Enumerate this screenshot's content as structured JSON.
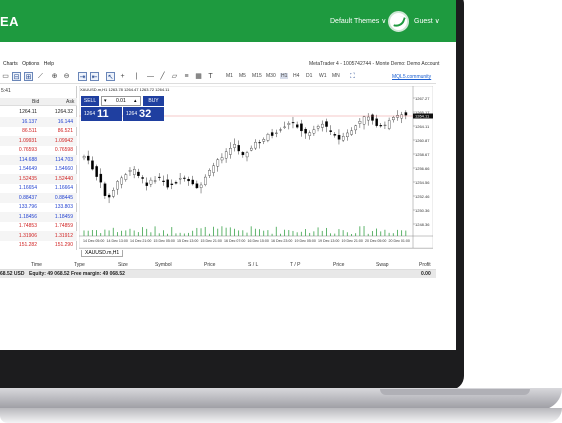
{
  "header": {
    "brand": "EA",
    "themes": "Default Themes ∨",
    "guest": "Guest ∨"
  },
  "menu": {
    "items": [
      "Charts",
      "Options",
      "Help"
    ],
    "title": "MetaTrader 4 - 1005742744 - Monte Demo: Demo Account"
  },
  "toolbar": {
    "timeframes": [
      "M1",
      "M5",
      "M15",
      "M30",
      "H1",
      "H4",
      "D1",
      "W1",
      "MN"
    ],
    "active": "H1",
    "community_link": "MQL5.community"
  },
  "market_watch": {
    "time": "5:41",
    "headers": {
      "bid": "Bid",
      "ask": "Ask"
    },
    "rows": [
      {
        "bid": "1264.11",
        "ask": "1264.32",
        "color": "#1a1a1a"
      },
      {
        "bid": "16.137",
        "ask": "16.144",
        "color": "#1f3fd0"
      },
      {
        "bid": "86.511",
        "ask": "86.521",
        "color": "#d02020"
      },
      {
        "bid": "1.09931",
        "ask": "1.09942",
        "color": "#d02020"
      },
      {
        "bid": "0.76593",
        "ask": "0.76598",
        "color": "#d02020"
      },
      {
        "bid": "114.688",
        "ask": "114.703",
        "color": "#1f3fd0"
      },
      {
        "bid": "1.54649",
        "ask": "1.54660",
        "color": "#1f3fd0"
      },
      {
        "bid": "1.52435",
        "ask": "1.52440",
        "color": "#d02020"
      },
      {
        "bid": "1.16654",
        "ask": "1.16664",
        "color": "#1f3fd0"
      },
      {
        "bid": "0.88437",
        "ask": "0.88445",
        "color": "#1f3fd0"
      },
      {
        "bid": "133.796",
        "ask": "133.803",
        "color": "#1f3fd0"
      },
      {
        "bid": "1.18456",
        "ask": "1.18459",
        "color": "#1f3fd0"
      },
      {
        "bid": "1.74853",
        "ask": "1.74859",
        "color": "#d02020"
      },
      {
        "bid": "1.31906",
        "ask": "1.31912",
        "color": "#d02020"
      },
      {
        "bid": "151.282",
        "ask": "151.290",
        "color": "#d02020"
      }
    ]
  },
  "chart": {
    "header": "XAUUSD.m,H1  1263.78 1264.47 1263.72 1264.11",
    "price_labels": [
      "1267.27",
      "1265.17",
      "1264.11",
      "1260.87",
      "1258.67",
      "1256.66",
      "1254.56",
      "1252.46",
      "1250.36",
      "1248.36"
    ],
    "current_price": "1264.11",
    "date_labels": [
      "14 Dec 05:00",
      "14 Dec 13:00",
      "14 Dec 21:00",
      "15 Dec 05:00",
      "15 Dec 13:00",
      "15 Dec 21:00",
      "16 Dec 07:00",
      "16 Dec 15:00",
      "16 Dec 23:00",
      "19 Dec 05:00",
      "19 Dec 13:00",
      "19 Dec 21:00",
      "20 Dec 05:00",
      "20 Dec 01:00"
    ],
    "tab": "XAUUSD.m,H1"
  },
  "trade": {
    "sell": "SELL",
    "lot": "0.01",
    "buy": "BUY",
    "bid_small": "1264",
    "bid_big": "11",
    "ask_small": "1264",
    "ask_big": "32"
  },
  "terminal": {
    "columns": [
      "Time",
      "Type",
      "Size",
      "Symbol",
      "Price",
      "S / L",
      "T / P",
      "Price",
      "Swap",
      "Profit"
    ],
    "summary_balance": "68.52 USD",
    "summary_rest": "Equity: 49 068.52   Free margin: 49 068.52",
    "summary_profit": "0.00"
  },
  "colors": {
    "header_green": "#1e9a3f",
    "bull": "#ffffff",
    "bear": "#000000",
    "trade_blue": "#1f3fa0"
  }
}
